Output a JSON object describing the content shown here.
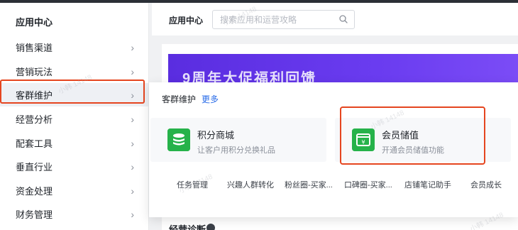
{
  "sidebar": {
    "title": "应用中心",
    "items": [
      {
        "label": "销售渠道"
      },
      {
        "label": "营销玩法"
      },
      {
        "label": "客群维护"
      },
      {
        "label": "经营分析"
      },
      {
        "label": "配套工具"
      },
      {
        "label": "垂直行业"
      },
      {
        "label": "资金处理"
      },
      {
        "label": "财务管理"
      }
    ],
    "chevron": "›"
  },
  "header": {
    "title": "应用中心",
    "search_placeholder": "搜索应用和运营攻略"
  },
  "banner": {
    "text": "9周年大促福利回馈"
  },
  "popup": {
    "title": "客群维护",
    "more_label": "更多",
    "cards": [
      {
        "name": "积分商城",
        "desc": "让客户用积分兑换礼品",
        "icon": "coins-stack-icon"
      },
      {
        "name": "会员储值",
        "desc": "开通会员储值功能",
        "icon": "wallet-yen-icon"
      }
    ],
    "links": [
      "任务管理",
      "兴趣人群转化",
      "粉丝圈-买家...",
      "口碑圈-买家...",
      "店铺笔记助手",
      "会员成长"
    ]
  },
  "section": {
    "title": "经营诊断"
  },
  "colors": {
    "accent_green": "#26b24a",
    "link_blue": "#2a6ce8",
    "highlight_red": "#e5451f",
    "banner_purple": "#5a2de0"
  }
}
